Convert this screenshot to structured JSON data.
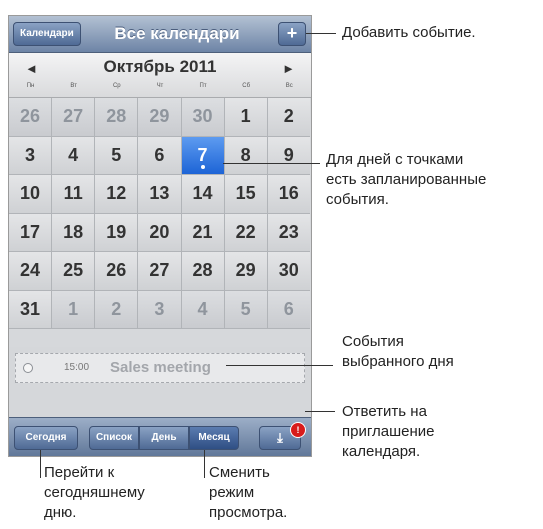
{
  "navbar": {
    "calendars_button": "Календари",
    "title": "Все календари",
    "add_button": "+"
  },
  "month_header": {
    "prev": "◄",
    "title": "Октябрь 2011",
    "next": "►",
    "weekdays": [
      "Пн",
      "Вт",
      "Ср",
      "Чт",
      "Пт",
      "Сб",
      "Вс"
    ]
  },
  "calendar": {
    "weeks": [
      [
        {
          "d": "26",
          "other": true
        },
        {
          "d": "27",
          "other": true
        },
        {
          "d": "28",
          "other": true
        },
        {
          "d": "29",
          "other": true
        },
        {
          "d": "30",
          "other": true
        },
        {
          "d": "1"
        },
        {
          "d": "2"
        }
      ],
      [
        {
          "d": "3"
        },
        {
          "d": "4"
        },
        {
          "d": "5"
        },
        {
          "d": "6"
        },
        {
          "d": "7",
          "selected": true,
          "dot": true
        },
        {
          "d": "8"
        },
        {
          "d": "9"
        }
      ],
      [
        {
          "d": "10"
        },
        {
          "d": "11"
        },
        {
          "d": "12"
        },
        {
          "d": "13"
        },
        {
          "d": "14"
        },
        {
          "d": "15"
        },
        {
          "d": "16"
        }
      ],
      [
        {
          "d": "17"
        },
        {
          "d": "18"
        },
        {
          "d": "19"
        },
        {
          "d": "20"
        },
        {
          "d": "21"
        },
        {
          "d": "22"
        },
        {
          "d": "23"
        }
      ],
      [
        {
          "d": "24"
        },
        {
          "d": "25"
        },
        {
          "d": "26"
        },
        {
          "d": "27"
        },
        {
          "d": "28"
        },
        {
          "d": "29"
        },
        {
          "d": "30"
        }
      ],
      [
        {
          "d": "31"
        },
        {
          "d": "1",
          "other": true
        },
        {
          "d": "2",
          "other": true
        },
        {
          "d": "3",
          "other": true
        },
        {
          "d": "4",
          "other": true
        },
        {
          "d": "5",
          "other": true
        },
        {
          "d": "6",
          "other": true
        }
      ]
    ]
  },
  "event": {
    "time": "15:00",
    "title": "Sales meeting"
  },
  "toolbar": {
    "today": "Сегодня",
    "list": "Список",
    "day": "День",
    "month": "Месяц",
    "inbox_icon": "⤓",
    "badge": "!"
  },
  "callouts": {
    "add_event": "Добавить событие.",
    "dots": [
      "Для дней с точками",
      "есть запланированные",
      "события."
    ],
    "day_events": [
      "События",
      "выбранного дня"
    ],
    "invite": [
      "Ответить на",
      "приглашение",
      "календаря."
    ],
    "today": [
      "Перейти к",
      "сегодняшнему",
      "дню."
    ],
    "view": [
      "Сменить",
      "режим",
      "просмотра."
    ]
  },
  "colors": {
    "selected_day": "#1d64d6",
    "badge": "#d81b1b",
    "navbar": "#6d84a6"
  }
}
